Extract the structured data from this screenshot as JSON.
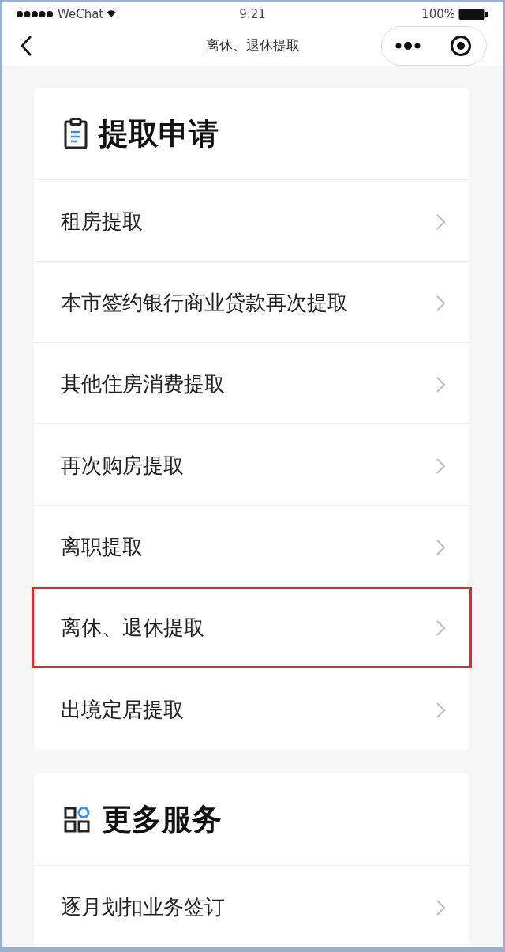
{
  "status_bar": {
    "carrier": "WeChat",
    "time": "9:21",
    "battery": "100%"
  },
  "nav": {
    "title": "离休、退休提取"
  },
  "sections": [
    {
      "title": "提取申请",
      "kind": "clipboard",
      "items": [
        {
          "label": "租房提取",
          "highlighted": false
        },
        {
          "label": "本市签约银行商业贷款再次提取",
          "highlighted": false
        },
        {
          "label": "其他住房消费提取",
          "highlighted": false
        },
        {
          "label": "再次购房提取",
          "highlighted": false
        },
        {
          "label": "离职提取",
          "highlighted": false
        },
        {
          "label": "离休、退休提取",
          "highlighted": true
        },
        {
          "label": "出境定居提取",
          "highlighted": false
        }
      ]
    },
    {
      "title": "更多服务",
      "kind": "grid",
      "items": [
        {
          "label": "逐月划扣业务签订",
          "highlighted": false
        }
      ]
    }
  ]
}
